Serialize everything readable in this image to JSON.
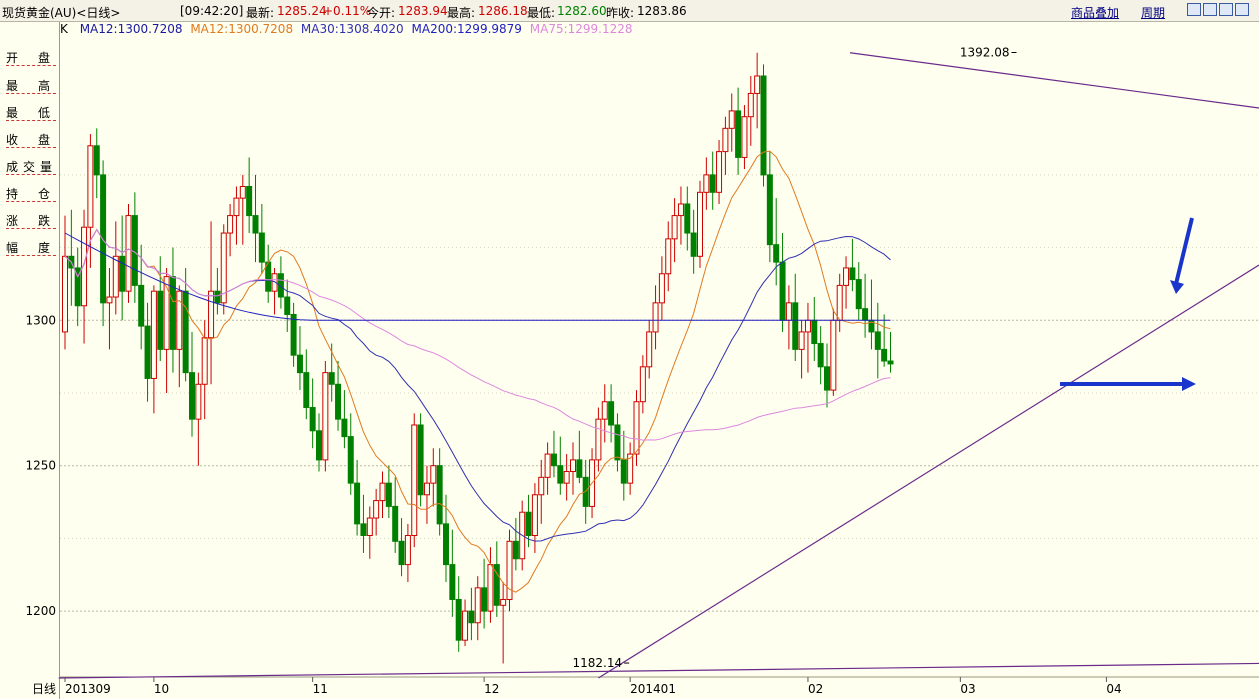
{
  "header": {
    "instrument": "现货黄金(AU)<日线>",
    "time": "[09:42:20]",
    "latest_label": "最新:",
    "latest_value": "1285.24",
    "change": "+0.11%",
    "open_label": "今开:",
    "open_value": "1283.94",
    "high_label": "最高:",
    "high_value": "1286.18",
    "low_label": "最低:",
    "low_value": "1282.60",
    "prev_close_label": "昨收:",
    "prev_close_value": "1283.86",
    "overlay_link": "商品叠加",
    "period_link": "周期"
  },
  "left_panel": {
    "items": [
      "开盘",
      "最高",
      "最低",
      "收盘",
      "成交量",
      "持仓",
      "涨跌",
      "幅度"
    ]
  },
  "ma_legend": [
    {
      "label": "K",
      "color": "#000000"
    },
    {
      "label": "MA12:1300.7208",
      "color": "#1a1aa0"
    },
    {
      "label": "MA12:1300.7208",
      "color": "#e07a20"
    },
    {
      "label": "MA30:1308.4020",
      "color": "#3030b0"
    },
    {
      "label": "MA200:1299.9879",
      "color": "#2020c0"
    },
    {
      "label": "MA75:1299.1228",
      "color": "#dd88dd"
    }
  ],
  "chart_data": {
    "type": "candlestick",
    "ylim": [
      1177,
      1395
    ],
    "yticks": [
      1200,
      1250,
      1300
    ],
    "x_axis_title": "日线",
    "x_tick_labels": [
      "201309",
      "10",
      "11",
      "12",
      "201401",
      "02",
      "03",
      "04"
    ],
    "x_tick_label_candle_index": [
      0,
      14,
      39,
      66,
      89,
      117,
      141,
      164
    ],
    "annotations": [
      {
        "text": "1392.08",
        "value": 1392.08,
        "candle_index": 150
      },
      {
        "text": "1182.14",
        "value": 1182.14,
        "candle_index": 89
      }
    ],
    "colors": {
      "up": "#cc0000",
      "down": "#008000",
      "ma12": "#e07a20",
      "ma30": "#3030b0",
      "ma200": "#2020c0",
      "ma75": "#dd88dd",
      "trendline": "#6a2a8a",
      "arrow": "#1a35cc"
    },
    "candles": [
      [
        1296,
        1336,
        1290,
        1322
      ],
      [
        1322,
        1338,
        1305,
        1318
      ],
      [
        1318,
        1325,
        1298,
        1305
      ],
      [
        1305,
        1338,
        1292,
        1332
      ],
      [
        1332,
        1364,
        1318,
        1360
      ],
      [
        1360,
        1366,
        1342,
        1350
      ],
      [
        1350,
        1355,
        1298,
        1306
      ],
      [
        1306,
        1318,
        1290,
        1308
      ],
      [
        1308,
        1334,
        1302,
        1322
      ],
      [
        1322,
        1336,
        1300,
        1310
      ],
      [
        1310,
        1340,
        1306,
        1336
      ],
      [
        1336,
        1344,
        1306,
        1312
      ],
      [
        1312,
        1326,
        1290,
        1298
      ],
      [
        1298,
        1306,
        1272,
        1280
      ],
      [
        1280,
        1312,
        1268,
        1310
      ],
      [
        1310,
        1322,
        1286,
        1290
      ],
      [
        1290,
        1318,
        1275,
        1315
      ],
      [
        1315,
        1325,
        1282,
        1290
      ],
      [
        1290,
        1312,
        1277,
        1310
      ],
      [
        1310,
        1318,
        1279,
        1282
      ],
      [
        1282,
        1296,
        1260,
        1266
      ],
      [
        1266,
        1282,
        1250,
        1278
      ],
      [
        1278,
        1300,
        1266,
        1294
      ],
      [
        1294,
        1334,
        1278,
        1310
      ],
      [
        1310,
        1318,
        1302,
        1306
      ],
      [
        1306,
        1333,
        1302,
        1330
      ],
      [
        1330,
        1340,
        1322,
        1336
      ],
      [
        1336,
        1346,
        1326,
        1342
      ],
      [
        1342,
        1350,
        1326,
        1346
      ],
      [
        1346,
        1356,
        1330,
        1336
      ],
      [
        1336,
        1350,
        1320,
        1330
      ],
      [
        1330,
        1340,
        1316,
        1320
      ],
      [
        1320,
        1326,
        1306,
        1310
      ],
      [
        1310,
        1318,
        1302,
        1316
      ],
      [
        1316,
        1322,
        1304,
        1308
      ],
      [
        1308,
        1314,
        1296,
        1302
      ],
      [
        1302,
        1306,
        1284,
        1288
      ],
      [
        1288,
        1298,
        1276,
        1282
      ],
      [
        1282,
        1290,
        1266,
        1270
      ],
      [
        1270,
        1280,
        1256,
        1262
      ],
      [
        1262,
        1268,
        1248,
        1252
      ],
      [
        1252,
        1286,
        1248,
        1282
      ],
      [
        1282,
        1292,
        1272,
        1278
      ],
      [
        1278,
        1286,
        1262,
        1266
      ],
      [
        1266,
        1276,
        1256,
        1260
      ],
      [
        1260,
        1268,
        1240,
        1244
      ],
      [
        1244,
        1252,
        1226,
        1230
      ],
      [
        1230,
        1240,
        1220,
        1226
      ],
      [
        1226,
        1236,
        1218,
        1232
      ],
      [
        1232,
        1242,
        1226,
        1238
      ],
      [
        1238,
        1248,
        1232,
        1244
      ],
      [
        1244,
        1250,
        1232,
        1236
      ],
      [
        1236,
        1246,
        1220,
        1224
      ],
      [
        1224,
        1232,
        1212,
        1216
      ],
      [
        1216,
        1230,
        1210,
        1226
      ],
      [
        1226,
        1268,
        1222,
        1264
      ],
      [
        1264,
        1268,
        1236,
        1240
      ],
      [
        1240,
        1250,
        1230,
        1244
      ],
      [
        1244,
        1256,
        1236,
        1250
      ],
      [
        1250,
        1256,
        1226,
        1230
      ],
      [
        1230,
        1240,
        1210,
        1216
      ],
      [
        1216,
        1228,
        1198,
        1204
      ],
      [
        1204,
        1212,
        1186,
        1190
      ],
      [
        1190,
        1204,
        1188,
        1200
      ],
      [
        1200,
        1208,
        1190,
        1196
      ],
      [
        1196,
        1212,
        1190,
        1208
      ],
      [
        1208,
        1218,
        1194,
        1200
      ],
      [
        1200,
        1222,
        1196,
        1216
      ],
      [
        1216,
        1224,
        1198,
        1202
      ],
      [
        1202,
        1210,
        1182,
        1204
      ],
      [
        1204,
        1228,
        1200,
        1224
      ],
      [
        1224,
        1232,
        1214,
        1218
      ],
      [
        1218,
        1238,
        1214,
        1234
      ],
      [
        1234,
        1240,
        1222,
        1226
      ],
      [
        1226,
        1244,
        1220,
        1240
      ],
      [
        1240,
        1252,
        1230,
        1246
      ],
      [
        1246,
        1258,
        1240,
        1254
      ],
      [
        1254,
        1262,
        1246,
        1250
      ],
      [
        1250,
        1260,
        1240,
        1244
      ],
      [
        1244,
        1254,
        1238,
        1248
      ],
      [
        1248,
        1258,
        1240,
        1252
      ],
      [
        1252,
        1262,
        1244,
        1246
      ],
      [
        1246,
        1252,
        1230,
        1236
      ],
      [
        1236,
        1256,
        1232,
        1252
      ],
      [
        1252,
        1270,
        1248,
        1266
      ],
      [
        1266,
        1278,
        1258,
        1272
      ],
      [
        1272,
        1278,
        1258,
        1264
      ],
      [
        1264,
        1268,
        1248,
        1252
      ],
      [
        1252,
        1262,
        1238,
        1244
      ],
      [
        1244,
        1258,
        1240,
        1254
      ],
      [
        1254,
        1276,
        1250,
        1272
      ],
      [
        1272,
        1288,
        1268,
        1284
      ],
      [
        1284,
        1300,
        1280,
        1296
      ],
      [
        1296,
        1312,
        1290,
        1306
      ],
      [
        1306,
        1322,
        1300,
        1316
      ],
      [
        1316,
        1334,
        1310,
        1328
      ],
      [
        1328,
        1342,
        1320,
        1336
      ],
      [
        1336,
        1346,
        1326,
        1340
      ],
      [
        1340,
        1346,
        1324,
        1330
      ],
      [
        1330,
        1338,
        1316,
        1322
      ],
      [
        1322,
        1348,
        1318,
        1344
      ],
      [
        1344,
        1356,
        1338,
        1350
      ],
      [
        1350,
        1358,
        1338,
        1344
      ],
      [
        1344,
        1362,
        1340,
        1358
      ],
      [
        1358,
        1370,
        1350,
        1366
      ],
      [
        1366,
        1378,
        1358,
        1372
      ],
      [
        1372,
        1380,
        1350,
        1356
      ],
      [
        1356,
        1374,
        1352,
        1370
      ],
      [
        1370,
        1384,
        1360,
        1378
      ],
      [
        1378,
        1392,
        1366,
        1384
      ],
      [
        1384,
        1388,
        1346,
        1350
      ],
      [
        1350,
        1358,
        1320,
        1326
      ],
      [
        1326,
        1342,
        1312,
        1320
      ],
      [
        1320,
        1330,
        1296,
        1300
      ],
      [
        1300,
        1312,
        1290,
        1306
      ],
      [
        1306,
        1316,
        1286,
        1290
      ],
      [
        1290,
        1300,
        1280,
        1296
      ],
      [
        1296,
        1306,
        1282,
        1300
      ],
      [
        1300,
        1308,
        1286,
        1292
      ],
      [
        1292,
        1298,
        1278,
        1284
      ],
      [
        1284,
        1292,
        1270,
        1276
      ],
      [
        1276,
        1304,
        1274,
        1300
      ],
      [
        1300,
        1316,
        1296,
        1312
      ],
      [
        1312,
        1322,
        1304,
        1318
      ],
      [
        1318,
        1328,
        1310,
        1314
      ],
      [
        1314,
        1320,
        1300,
        1304
      ],
      [
        1304,
        1316,
        1294,
        1300
      ],
      [
        1300,
        1314,
        1290,
        1296
      ],
      [
        1296,
        1306,
        1280,
        1290
      ],
      [
        1290,
        1302,
        1284,
        1286
      ],
      [
        1286,
        1296,
        1282,
        1285
      ]
    ]
  }
}
